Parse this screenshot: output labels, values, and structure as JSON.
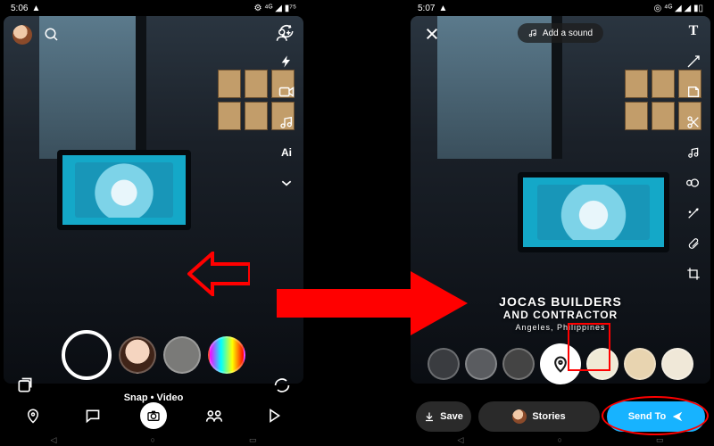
{
  "left": {
    "status": {
      "time": "5:06",
      "icons": "▲",
      "right": "⚙ ⁴ᴳ ◢ ▮⁷⁵"
    },
    "toolbar": {
      "addfriend": "add-friend",
      "flip": "flip",
      "flash": "flash",
      "videocam": "video",
      "music": "music",
      "ai": "Ai",
      "more": "more"
    },
    "snap_label": "Snap • Video",
    "nav": {
      "map": "map",
      "chat": "chat",
      "camera": "camera",
      "stories": "stories",
      "spotlight": "spotlight"
    }
  },
  "right": {
    "status": {
      "time": "5:07",
      "icons": "▲",
      "right": "◎ ⁴ᴳ ◢ ◢ ▮▯"
    },
    "sound_pill": "Add a sound",
    "tools": {
      "text": "T",
      "pencil": "pencil",
      "sticker": "sticker",
      "scissors": "scissors",
      "music": "music",
      "link": "loop",
      "magic": "magic",
      "timer": "timer",
      "crop": "crop"
    },
    "location": {
      "line1": "JOCAS BUILDERS",
      "line2": "AND CONTRACTOR",
      "line3": "Angeles, Philippines"
    },
    "actions": {
      "save": "Save",
      "stories": "Stories",
      "sendto": "Send To"
    }
  }
}
